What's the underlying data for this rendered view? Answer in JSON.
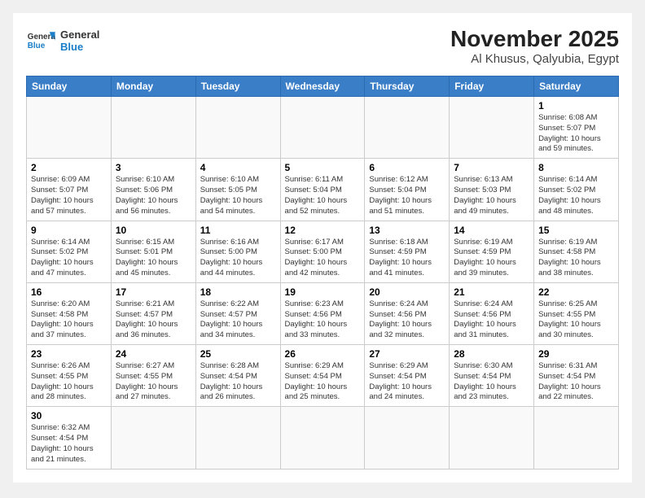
{
  "logo": {
    "general": "General",
    "blue": "Blue"
  },
  "title": "November 2025",
  "subtitle": "Al Khusus, Qalyubia, Egypt",
  "days_of_week": [
    "Sunday",
    "Monday",
    "Tuesday",
    "Wednesday",
    "Thursday",
    "Friday",
    "Saturday"
  ],
  "weeks": [
    [
      {
        "day": "",
        "info": ""
      },
      {
        "day": "",
        "info": ""
      },
      {
        "day": "",
        "info": ""
      },
      {
        "day": "",
        "info": ""
      },
      {
        "day": "",
        "info": ""
      },
      {
        "day": "",
        "info": ""
      },
      {
        "day": "1",
        "info": "Sunrise: 6:08 AM\nSunset: 5:07 PM\nDaylight: 10 hours and 59 minutes."
      }
    ],
    [
      {
        "day": "2",
        "info": "Sunrise: 6:09 AM\nSunset: 5:07 PM\nDaylight: 10 hours and 57 minutes."
      },
      {
        "day": "3",
        "info": "Sunrise: 6:10 AM\nSunset: 5:06 PM\nDaylight: 10 hours and 56 minutes."
      },
      {
        "day": "4",
        "info": "Sunrise: 6:10 AM\nSunset: 5:05 PM\nDaylight: 10 hours and 54 minutes."
      },
      {
        "day": "5",
        "info": "Sunrise: 6:11 AM\nSunset: 5:04 PM\nDaylight: 10 hours and 52 minutes."
      },
      {
        "day": "6",
        "info": "Sunrise: 6:12 AM\nSunset: 5:04 PM\nDaylight: 10 hours and 51 minutes."
      },
      {
        "day": "7",
        "info": "Sunrise: 6:13 AM\nSunset: 5:03 PM\nDaylight: 10 hours and 49 minutes."
      },
      {
        "day": "8",
        "info": "Sunrise: 6:14 AM\nSunset: 5:02 PM\nDaylight: 10 hours and 48 minutes."
      }
    ],
    [
      {
        "day": "9",
        "info": "Sunrise: 6:14 AM\nSunset: 5:02 PM\nDaylight: 10 hours and 47 minutes."
      },
      {
        "day": "10",
        "info": "Sunrise: 6:15 AM\nSunset: 5:01 PM\nDaylight: 10 hours and 45 minutes."
      },
      {
        "day": "11",
        "info": "Sunrise: 6:16 AM\nSunset: 5:00 PM\nDaylight: 10 hours and 44 minutes."
      },
      {
        "day": "12",
        "info": "Sunrise: 6:17 AM\nSunset: 5:00 PM\nDaylight: 10 hours and 42 minutes."
      },
      {
        "day": "13",
        "info": "Sunrise: 6:18 AM\nSunset: 4:59 PM\nDaylight: 10 hours and 41 minutes."
      },
      {
        "day": "14",
        "info": "Sunrise: 6:19 AM\nSunset: 4:59 PM\nDaylight: 10 hours and 39 minutes."
      },
      {
        "day": "15",
        "info": "Sunrise: 6:19 AM\nSunset: 4:58 PM\nDaylight: 10 hours and 38 minutes."
      }
    ],
    [
      {
        "day": "16",
        "info": "Sunrise: 6:20 AM\nSunset: 4:58 PM\nDaylight: 10 hours and 37 minutes."
      },
      {
        "day": "17",
        "info": "Sunrise: 6:21 AM\nSunset: 4:57 PM\nDaylight: 10 hours and 36 minutes."
      },
      {
        "day": "18",
        "info": "Sunrise: 6:22 AM\nSunset: 4:57 PM\nDaylight: 10 hours and 34 minutes."
      },
      {
        "day": "19",
        "info": "Sunrise: 6:23 AM\nSunset: 4:56 PM\nDaylight: 10 hours and 33 minutes."
      },
      {
        "day": "20",
        "info": "Sunrise: 6:24 AM\nSunset: 4:56 PM\nDaylight: 10 hours and 32 minutes."
      },
      {
        "day": "21",
        "info": "Sunrise: 6:24 AM\nSunset: 4:56 PM\nDaylight: 10 hours and 31 minutes."
      },
      {
        "day": "22",
        "info": "Sunrise: 6:25 AM\nSunset: 4:55 PM\nDaylight: 10 hours and 30 minutes."
      }
    ],
    [
      {
        "day": "23",
        "info": "Sunrise: 6:26 AM\nSunset: 4:55 PM\nDaylight: 10 hours and 28 minutes."
      },
      {
        "day": "24",
        "info": "Sunrise: 6:27 AM\nSunset: 4:55 PM\nDaylight: 10 hours and 27 minutes."
      },
      {
        "day": "25",
        "info": "Sunrise: 6:28 AM\nSunset: 4:54 PM\nDaylight: 10 hours and 26 minutes."
      },
      {
        "day": "26",
        "info": "Sunrise: 6:29 AM\nSunset: 4:54 PM\nDaylight: 10 hours and 25 minutes."
      },
      {
        "day": "27",
        "info": "Sunrise: 6:29 AM\nSunset: 4:54 PM\nDaylight: 10 hours and 24 minutes."
      },
      {
        "day": "28",
        "info": "Sunrise: 6:30 AM\nSunset: 4:54 PM\nDaylight: 10 hours and 23 minutes."
      },
      {
        "day": "29",
        "info": "Sunrise: 6:31 AM\nSunset: 4:54 PM\nDaylight: 10 hours and 22 minutes."
      }
    ],
    [
      {
        "day": "30",
        "info": "Sunrise: 6:32 AM\nSunset: 4:54 PM\nDaylight: 10 hours and 21 minutes."
      },
      {
        "day": "",
        "info": ""
      },
      {
        "day": "",
        "info": ""
      },
      {
        "day": "",
        "info": ""
      },
      {
        "day": "",
        "info": ""
      },
      {
        "day": "",
        "info": ""
      },
      {
        "day": "",
        "info": ""
      }
    ]
  ]
}
